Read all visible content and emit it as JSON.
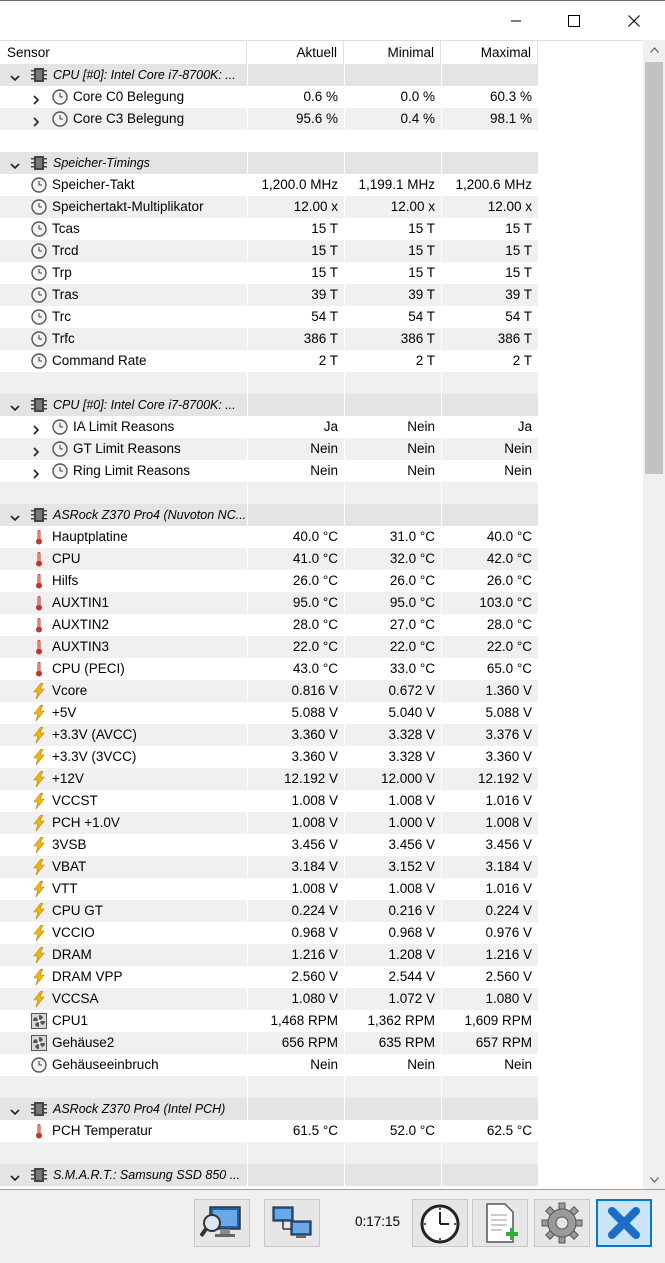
{
  "window": {
    "minimize_icon": "minimize-icon",
    "maximize_icon": "maximize-icon",
    "close_icon": "close-icon"
  },
  "table": {
    "columns": [
      "Sensor",
      "Aktuell",
      "Minimal",
      "Maximal"
    ],
    "rows": [
      {
        "type": "group",
        "name": "CPU [#0]: Intel Core i7-8700K: ...",
        "icon": "chip-icon",
        "expanded": true
      },
      {
        "type": "sensor",
        "name": "Core C0 Belegung",
        "icon": "clock-icon",
        "expandable": true,
        "values": [
          "0.6 %",
          "0.0 %",
          "60.3 %"
        ]
      },
      {
        "type": "sensor",
        "name": "Core C3 Belegung",
        "icon": "clock-icon",
        "expandable": true,
        "values": [
          "95.6 %",
          "0.4 %",
          "98.1 %"
        ]
      },
      {
        "type": "blank"
      },
      {
        "type": "group",
        "name": "Speicher-Timings",
        "icon": "chip-icon",
        "expanded": true
      },
      {
        "type": "sensor",
        "name": "Speicher-Takt",
        "icon": "clock-icon",
        "values": [
          "1,200.0 MHz",
          "1,199.1 MHz",
          "1,200.6 MHz"
        ]
      },
      {
        "type": "sensor",
        "name": "Speichertakt-Multiplikator",
        "icon": "clock-icon",
        "values": [
          "12.00 x",
          "12.00 x",
          "12.00 x"
        ]
      },
      {
        "type": "sensor",
        "name": "Tcas",
        "icon": "clock-icon",
        "values": [
          "15 T",
          "15 T",
          "15 T"
        ]
      },
      {
        "type": "sensor",
        "name": "Trcd",
        "icon": "clock-icon",
        "values": [
          "15 T",
          "15 T",
          "15 T"
        ]
      },
      {
        "type": "sensor",
        "name": "Trp",
        "icon": "clock-icon",
        "values": [
          "15 T",
          "15 T",
          "15 T"
        ]
      },
      {
        "type": "sensor",
        "name": "Tras",
        "icon": "clock-icon",
        "values": [
          "39 T",
          "39 T",
          "39 T"
        ]
      },
      {
        "type": "sensor",
        "name": "Trc",
        "icon": "clock-icon",
        "values": [
          "54 T",
          "54 T",
          "54 T"
        ]
      },
      {
        "type": "sensor",
        "name": "Trfc",
        "icon": "clock-icon",
        "values": [
          "386 T",
          "386 T",
          "386 T"
        ]
      },
      {
        "type": "sensor",
        "name": "Command Rate",
        "icon": "clock-icon",
        "values": [
          "2 T",
          "2 T",
          "2 T"
        ]
      },
      {
        "type": "blank"
      },
      {
        "type": "group",
        "name": "CPU [#0]: Intel Core i7-8700K: ...",
        "icon": "chip-icon",
        "expanded": true
      },
      {
        "type": "sensor",
        "name": "IA Limit Reasons",
        "icon": "clock-icon",
        "expandable": true,
        "values": [
          "Ja",
          "Nein",
          "Ja"
        ]
      },
      {
        "type": "sensor",
        "name": "GT Limit Reasons",
        "icon": "clock-icon",
        "expandable": true,
        "values": [
          "Nein",
          "Nein",
          "Nein"
        ]
      },
      {
        "type": "sensor",
        "name": "Ring Limit Reasons",
        "icon": "clock-icon",
        "expandable": true,
        "values": [
          "Nein",
          "Nein",
          "Nein"
        ]
      },
      {
        "type": "blank"
      },
      {
        "type": "group",
        "name": "ASRock Z370 Pro4 (Nuvoton NC...",
        "icon": "chip-icon",
        "expanded": true
      },
      {
        "type": "sensor",
        "name": "Hauptplatine",
        "icon": "thermometer-icon",
        "values": [
          "40.0 °C",
          "31.0 °C",
          "40.0 °C"
        ]
      },
      {
        "type": "sensor",
        "name": "CPU",
        "icon": "thermometer-icon",
        "values": [
          "41.0 °C",
          "32.0 °C",
          "42.0 °C"
        ]
      },
      {
        "type": "sensor",
        "name": "Hilfs",
        "icon": "thermometer-icon",
        "values": [
          "26.0 °C",
          "26.0 °C",
          "26.0 °C"
        ]
      },
      {
        "type": "sensor",
        "name": "AUXTIN1",
        "icon": "thermometer-icon",
        "values": [
          "95.0 °C",
          "95.0 °C",
          "103.0 °C"
        ]
      },
      {
        "type": "sensor",
        "name": "AUXTIN2",
        "icon": "thermometer-icon",
        "values": [
          "28.0 °C",
          "27.0 °C",
          "28.0 °C"
        ]
      },
      {
        "type": "sensor",
        "name": "AUXTIN3",
        "icon": "thermometer-icon",
        "values": [
          "22.0 °C",
          "22.0 °C",
          "22.0 °C"
        ]
      },
      {
        "type": "sensor",
        "name": "CPU (PECI)",
        "icon": "thermometer-icon",
        "values": [
          "43.0 °C",
          "33.0 °C",
          "65.0 °C"
        ]
      },
      {
        "type": "sensor",
        "name": "Vcore",
        "icon": "lightning-icon",
        "values": [
          "0.816 V",
          "0.672 V",
          "1.360 V"
        ]
      },
      {
        "type": "sensor",
        "name": "+5V",
        "icon": "lightning-icon",
        "values": [
          "5.088 V",
          "5.040 V",
          "5.088 V"
        ]
      },
      {
        "type": "sensor",
        "name": "+3.3V (AVCC)",
        "icon": "lightning-icon",
        "values": [
          "3.360 V",
          "3.328 V",
          "3.376 V"
        ]
      },
      {
        "type": "sensor",
        "name": "+3.3V (3VCC)",
        "icon": "lightning-icon",
        "values": [
          "3.360 V",
          "3.328 V",
          "3.360 V"
        ]
      },
      {
        "type": "sensor",
        "name": "+12V",
        "icon": "lightning-icon",
        "values": [
          "12.192 V",
          "12.000 V",
          "12.192 V"
        ]
      },
      {
        "type": "sensor",
        "name": "VCCST",
        "icon": "lightning-icon",
        "values": [
          "1.008 V",
          "1.008 V",
          "1.016 V"
        ]
      },
      {
        "type": "sensor",
        "name": "PCH +1.0V",
        "icon": "lightning-icon",
        "values": [
          "1.008 V",
          "1.000 V",
          "1.008 V"
        ]
      },
      {
        "type": "sensor",
        "name": "3VSB",
        "icon": "lightning-icon",
        "values": [
          "3.456 V",
          "3.456 V",
          "3.456 V"
        ]
      },
      {
        "type": "sensor",
        "name": "VBAT",
        "icon": "lightning-icon",
        "values": [
          "3.184 V",
          "3.152 V",
          "3.184 V"
        ]
      },
      {
        "type": "sensor",
        "name": "VTT",
        "icon": "lightning-icon",
        "values": [
          "1.008 V",
          "1.008 V",
          "1.016 V"
        ]
      },
      {
        "type": "sensor",
        "name": "CPU GT",
        "icon": "lightning-icon",
        "values": [
          "0.224 V",
          "0.216 V",
          "0.224 V"
        ]
      },
      {
        "type": "sensor",
        "name": "VCCIO",
        "icon": "lightning-icon",
        "values": [
          "0.968 V",
          "0.968 V",
          "0.976 V"
        ]
      },
      {
        "type": "sensor",
        "name": "DRAM",
        "icon": "lightning-icon",
        "values": [
          "1.216 V",
          "1.208 V",
          "1.216 V"
        ]
      },
      {
        "type": "sensor",
        "name": "DRAM VPP",
        "icon": "lightning-icon",
        "values": [
          "2.560 V",
          "2.544 V",
          "2.560 V"
        ]
      },
      {
        "type": "sensor",
        "name": "VCCSA",
        "icon": "lightning-icon",
        "values": [
          "1.080 V",
          "1.072 V",
          "1.080 V"
        ]
      },
      {
        "type": "sensor",
        "name": "CPU1",
        "icon": "fan-icon",
        "values": [
          "1,468 RPM",
          "1,362 RPM",
          "1,609 RPM"
        ]
      },
      {
        "type": "sensor",
        "name": "Gehäuse2",
        "icon": "fan-icon",
        "values": [
          "656 RPM",
          "635 RPM",
          "657 RPM"
        ]
      },
      {
        "type": "sensor",
        "name": "Gehäuseeinbruch",
        "icon": "clock-icon",
        "values": [
          "Nein",
          "Nein",
          "Nein"
        ]
      },
      {
        "type": "blank"
      },
      {
        "type": "group",
        "name": "ASRock Z370 Pro4 (Intel PCH)",
        "icon": "chip-icon",
        "expanded": true
      },
      {
        "type": "sensor",
        "name": "PCH Temperatur",
        "icon": "thermometer-icon",
        "values": [
          "61.5 °C",
          "52.0 °C",
          "62.5 °C"
        ]
      },
      {
        "type": "blank"
      },
      {
        "type": "group",
        "name": "S.M.A.R.T.: Samsung SSD 850 ...",
        "icon": "chip-icon",
        "expanded": true
      }
    ]
  },
  "toolbar": {
    "report_icon": "monitor-magnifier-icon",
    "network_icon": "network-computers-icon",
    "elapsed_time": "0:17:15",
    "clock_icon": "stopwatch-clock-icon",
    "add_report_icon": "document-add-icon",
    "settings_icon": "gear-icon",
    "close_icon": "close-x-icon"
  },
  "colors": {
    "shade": "#f0f0f0",
    "group": "#e4e4e4",
    "thermometer": "#c0392b",
    "lightning": "#f5b800",
    "accent": "#0078d7"
  }
}
